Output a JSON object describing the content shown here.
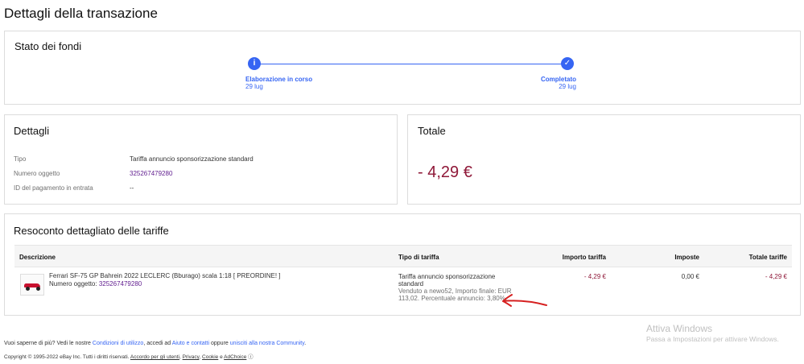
{
  "page_title": "Dettagli della transazione",
  "status": {
    "title": "Stato dei fondi",
    "steps": [
      {
        "icon": "info-icon",
        "glyph": "i",
        "label": "Elaborazione in corso",
        "date": "29 lug"
      },
      {
        "icon": "check-icon",
        "glyph": "✓",
        "label": "Completato",
        "date": "29 lug"
      }
    ],
    "accent_color": "#3665f3"
  },
  "details": {
    "title": "Dettagli",
    "rows": [
      {
        "label": "Tipo",
        "value": "Tariffa annuncio sponsorizzazione standard"
      },
      {
        "label": "Numero oggetto",
        "value": "325267479280"
      },
      {
        "label": "ID del pagamento in entrata",
        "value": "--"
      }
    ]
  },
  "total": {
    "title": "Totale",
    "amount": "- 4,29 €",
    "amount_color": "#8f1838"
  },
  "fees": {
    "title": "Resoconto dettagliato delle tariffe",
    "columns": [
      "Descrizione",
      "Tipo di tariffa",
      "Importo tariffa",
      "Imposte",
      "Totale tariffe"
    ],
    "row": {
      "item_title": "Ferrari SF-75 GP Bahrein 2022 LECLERC (Bburago) scala 1:18 [ PREORDINE! ]",
      "item_number_label": "Numero oggetto:",
      "item_number": "325267479280",
      "fee_type": "Tariffa annuncio sponsorizzazione standard",
      "fee_detail": "Venduto a newo52, Importo finale: EUR 113,02. Percentuale annuncio: 3,80%.",
      "fee_amount": "- 4,29 €",
      "taxes": "0,00 €",
      "total": "- 4,29 €"
    }
  },
  "footer": {
    "line1_prefix": "Vuoi saperne di più? Vedi le nostre",
    "line1_link1": "Condizioni di utilizzo",
    "line1_mid1": ", accedi ad",
    "line1_link2": "Aiuto e contatti",
    "line1_mid2": "oppure",
    "line1_link3": "unisciti alla nostra Community",
    "line1_end": ".",
    "line2_prefix": "Copyright © 1995-2022 eBay Inc. Tutti i diritti riservati.",
    "line2_link1": "Accordo per gli utenti",
    "line2_link2": "Privacy",
    "line2_link3": "Cookie",
    "line2_mid": "e",
    "line2_link4": "AdChoice"
  },
  "watermark": {
    "title": "Attiva Windows",
    "subtitle": "Passa a Impostazioni per attivare Windows."
  }
}
